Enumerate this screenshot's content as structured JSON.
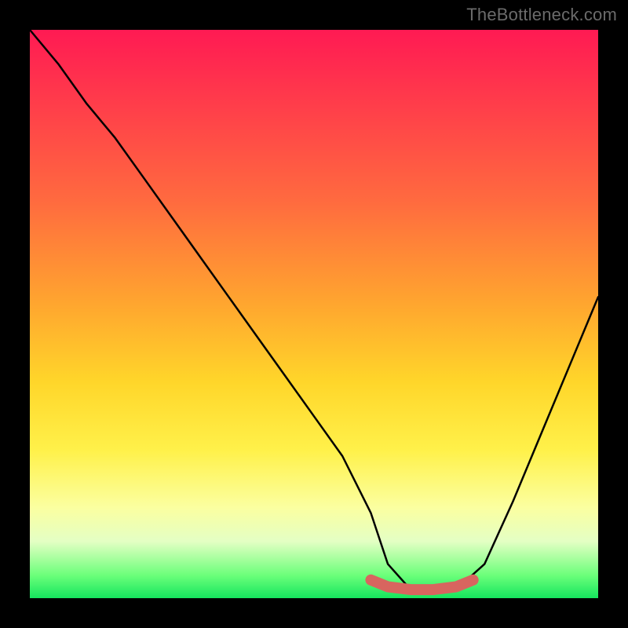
{
  "watermark": "TheBottleneck.com",
  "chart_data": {
    "type": "line",
    "title": "",
    "xlabel": "",
    "ylabel": "",
    "xlim": [
      0,
      100
    ],
    "ylim": [
      0,
      100
    ],
    "series": [
      {
        "name": "curve",
        "x": [
          0,
          5,
          10,
          15,
          20,
          25,
          30,
          35,
          40,
          45,
          50,
          55,
          60,
          63,
          67,
          71,
          75,
          80,
          85,
          90,
          95,
          100
        ],
        "values": [
          100,
          94,
          87,
          81,
          74,
          67,
          60,
          53,
          46,
          39,
          32,
          25,
          15,
          6,
          1.5,
          1.2,
          1.5,
          6,
          17,
          29,
          41,
          53
        ]
      }
    ],
    "highlight": {
      "name": "bottom-band",
      "color": "#d8655f",
      "x": [
        60,
        63,
        67,
        71,
        75,
        78
      ],
      "values": [
        3.2,
        2.0,
        1.5,
        1.5,
        2.0,
        3.2
      ]
    }
  }
}
